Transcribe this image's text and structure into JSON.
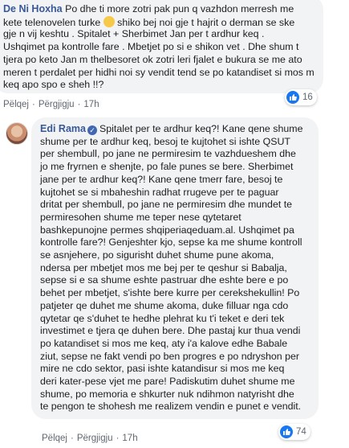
{
  "comment1": {
    "author": "De Ni Hoxha",
    "lines": [
      " Po dhe ti more zotri pak pun q vazhdon merresh me",
      "kete telenovelen turke ",
      " shiko bej noi gje t hajrit o derman se ske",
      "gje n vij keshtu . Spitalet + Sherbimet Jan per t ardhur keq .",
      "Ushqimet pa kontrolle fare . Mbetjet po si e shikon vet . Dhe shum t",
      "tjera po keto Jan m thelbesoret ok zotri leri fjalet e bukura se me ato",
      "meren t perdalet per hidhi noi sy vendit tend se po katandiset si mos m",
      "keq apo spo e sheh !!?"
    ],
    "emoji_icon": "thinking-face-icon",
    "actions": {
      "like": "Pëlqej",
      "reply": "Përgjigju",
      "time": "17h"
    },
    "reactions": {
      "icon": "like-icon",
      "count": "16"
    }
  },
  "comment2": {
    "author": "Edi Rama",
    "verified_icon": "verified-badge-icon",
    "lines": [
      "Spitalet per te ardhur keq?! Kane qene shume",
      "shume per te ardhur keq, besoj te kujtohet si ishte QSUT",
      "per shembull, po jane ne permiresim te vazhdueshem dhe",
      "jo me fryrnen e shenjte, po fale punes se bere. Sherbimet",
      "jane per te ardhur keq?! Kane qene tmerr fare, besoj te",
      "kujtohet se si mbaheshin radhat rrugeve per te paguar",
      "dritat per shembull, po jane ne permiresim dhe mundet te",
      "permiresohen shume me teper nese qytetaret",
      "bashkepunojne permes shqiperiaqeduam.al. Ushqimet pa",
      "kontrolle fare?! Genjeshter kjo, sepse ka me shume kontroll",
      "se asnjehere, po sigurisht duhet shume pune akoma,",
      "ndersa per mbetjet mos me bej per te qeshur si Babalja,",
      "sepse si e sa shume eshte pastruar dhe eshte bere e po",
      "behet per mbetjet, s'ishte bere kurre per cerekshekullin! Po",
      "patjeter qe duhet me shume akoma, duke filluar nga cdo",
      "qytetar qe s'duhet te hedhe plehrat ku t'i teket e deri tek",
      "investimet e tjera qe duhen bere. Dhe pastaj kur thua vendi",
      "po katandiset si mos me keq, aty i'a kalove edhe Babale",
      "ziut, sepse ne fakt vendi po ben progres e po ndryshon per",
      "mire ne cdo sektor, pasi ishte katandisur si mos me keq",
      "deri kater-pese vjet me pare! Padiskutim duhet shume me",
      "shume, po memoria e shkurter nuk ndihmon natyrisht dhe",
      "te pengon te shohesh me realizem vendin e punet e vendit."
    ],
    "actions": {
      "like": "Pëlqej",
      "reply": "Përgjigju",
      "time": "17h"
    },
    "reactions": {
      "icon": "like-icon",
      "count": "74"
    }
  }
}
